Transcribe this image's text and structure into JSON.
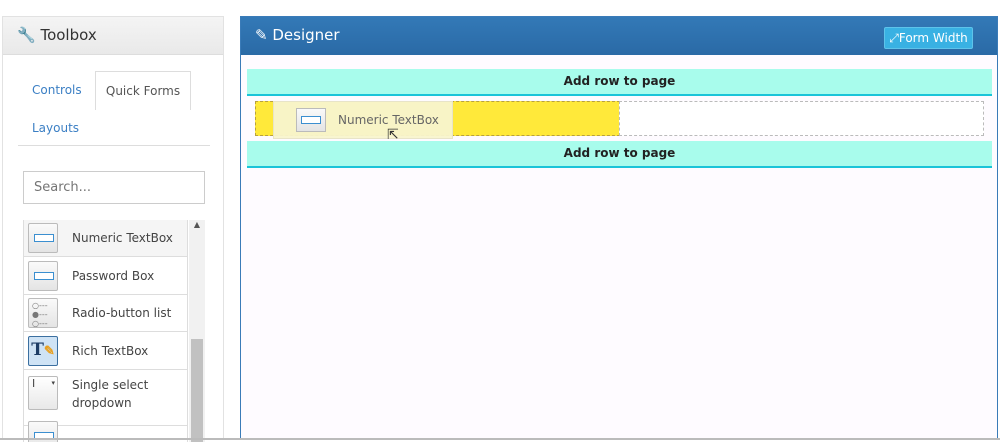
{
  "toolbox": {
    "title": "Toolbox",
    "icon": "wrench-icon",
    "tabs": [
      {
        "label": "Controls"
      },
      {
        "label": "Quick Forms"
      },
      {
        "label": "Layouts"
      }
    ],
    "search_placeholder": "Search...",
    "items": [
      {
        "label": "Numeric TextBox"
      },
      {
        "label": "Password Box"
      },
      {
        "label": "Radio-button list"
      },
      {
        "label": "Rich TextBox"
      },
      {
        "label": "Single select dropdown"
      }
    ]
  },
  "designer": {
    "title": "Designer",
    "icon": "pencil-ruler-icon",
    "form_width_label": "Form Width",
    "add_row_label": "Add row to page",
    "drag_item_label": "Numeric TextBox"
  },
  "colors": {
    "header_blue": "#2e76b4",
    "add_row": "#a8fcec",
    "drop_target": "#ffe93a",
    "button": "#39b1e3"
  }
}
